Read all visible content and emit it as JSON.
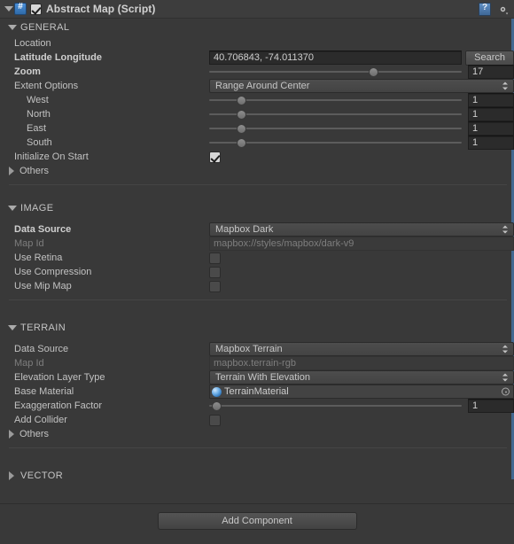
{
  "component": {
    "title": "Abstract Map (Script)",
    "enabled_checkbox": "checked",
    "script_icon": "csharp-script-icon",
    "help_icon": "help-book-icon",
    "settings_icon": "gear-icon"
  },
  "sections": {
    "general": {
      "title": "GENERAL",
      "expanded": true,
      "location_label": "Location",
      "latlon_label": "Latitude Longitude",
      "latlon_value": "40.706843, -74.011370",
      "search_label": "Search",
      "zoom_label": "Zoom",
      "zoom_value": "17",
      "zoom_slider_pct": 63,
      "extent_label": "Extent Options",
      "extent_value": "Range Around Center",
      "west_label": "West",
      "west_value": "1",
      "north_label": "North",
      "north_value": "1",
      "east_label": "East",
      "east_value": "1",
      "south_label": "South",
      "south_value": "1",
      "extent_slider_pct": 11,
      "init_label": "Initialize On Start",
      "init_checked": true,
      "others_label": "Others"
    },
    "image": {
      "title": "IMAGE",
      "expanded": true,
      "data_source_label": "Data Source",
      "data_source_value": "Mapbox Dark",
      "map_id_label": "Map Id",
      "map_id_value": "mapbox://styles/mapbox/dark-v9",
      "retina_label": "Use Retina",
      "retina_checked": false,
      "compression_label": "Use Compression",
      "compression_checked": false,
      "mipmap_label": "Use Mip Map",
      "mipmap_checked": false
    },
    "terrain": {
      "title": "TERRAIN",
      "expanded": true,
      "data_source_label": "Data Source",
      "data_source_value": "Mapbox Terrain",
      "map_id_label": "Map Id",
      "map_id_value": "mapbox.terrain-rgb",
      "elevation_label": "Elevation Layer Type",
      "elevation_value": "Terrain With Elevation",
      "base_material_label": "Base Material",
      "base_material_value": "TerrainMaterial",
      "exaggeration_label": "Exaggeration Factor",
      "exaggeration_value": "1",
      "exaggeration_slider_pct": 2,
      "collider_label": "Add Collider",
      "collider_checked": false,
      "others_label": "Others"
    },
    "vector": {
      "title": "VECTOR",
      "expanded": false
    }
  },
  "footer": {
    "add_component_label": "Add Component"
  },
  "colors": {
    "background": "#393939",
    "header": "#3d3d3d",
    "text": "#c2c2c2",
    "dim_text": "#7d7d7d",
    "field": "#2b2b2b",
    "accent": "#4a8fd8"
  }
}
